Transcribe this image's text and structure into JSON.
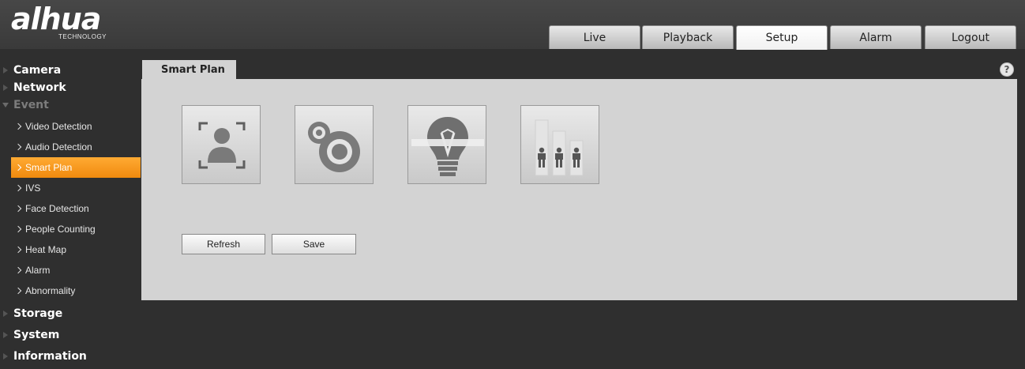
{
  "logo": {
    "brand": "alhua",
    "tagline": "TECHNOLOGY"
  },
  "nav_tabs": [
    {
      "label": "Live",
      "active": false
    },
    {
      "label": "Playback",
      "active": false
    },
    {
      "label": "Setup",
      "active": true
    },
    {
      "label": "Alarm",
      "active": false
    },
    {
      "label": "Logout",
      "active": false
    }
  ],
  "sidebar": {
    "groups": [
      {
        "label": "Camera",
        "expanded": false
      },
      {
        "label": "Network",
        "expanded": false
      },
      {
        "label": "Event",
        "expanded": true,
        "items": [
          {
            "label": "Video Detection",
            "active": false
          },
          {
            "label": "Audio Detection",
            "active": false
          },
          {
            "label": "Smart Plan",
            "active": true
          },
          {
            "label": "IVS",
            "active": false
          },
          {
            "label": "Face Detection",
            "active": false
          },
          {
            "label": "People Counting",
            "active": false
          },
          {
            "label": "Heat Map",
            "active": false
          },
          {
            "label": "Alarm",
            "active": false
          },
          {
            "label": "Abnormality",
            "active": false
          }
        ]
      },
      {
        "label": "Storage",
        "expanded": false
      },
      {
        "label": "System",
        "expanded": false
      },
      {
        "label": "Information",
        "expanded": false
      }
    ]
  },
  "main": {
    "tab_title": "Smart Plan",
    "help_icon": "?",
    "plans": [
      {
        "icon": "face-detection-icon"
      },
      {
        "icon": "heat-map-icon"
      },
      {
        "icon": "ivs-icon"
      },
      {
        "icon": "people-counting-icon"
      }
    ],
    "buttons": {
      "refresh": "Refresh",
      "save": "Save"
    }
  },
  "colors": {
    "accent": "#f59a1f",
    "background": "#2f2f2f",
    "panel": "#d3d3d3"
  }
}
